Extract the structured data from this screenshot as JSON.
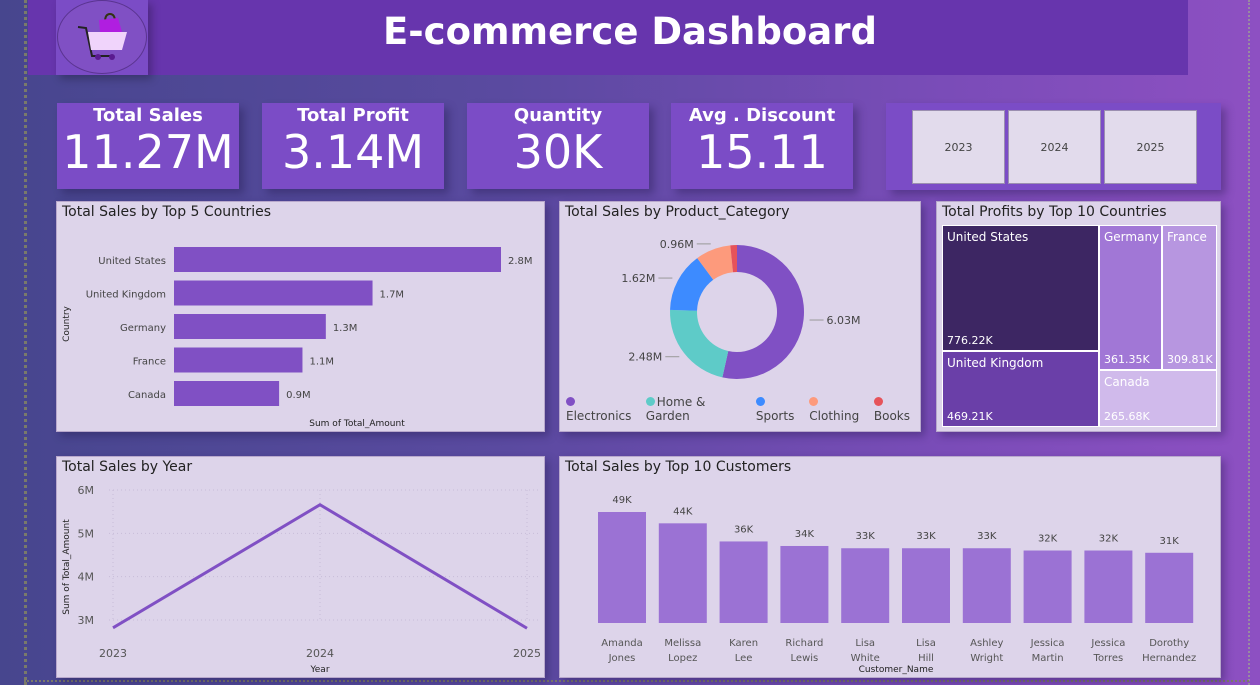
{
  "header": {
    "title": "E-commerce Dashboard",
    "logo_icon": "shopping-cart-icon"
  },
  "kpis": [
    {
      "label": "Total Sales",
      "value": "11.27M"
    },
    {
      "label": "Total Profit",
      "value": "3.14M"
    },
    {
      "label": "Quantity",
      "value": "30K"
    },
    {
      "label": "Avg . Discount",
      "value": "15.11"
    }
  ],
  "year_slicer": [
    "2023",
    "2024",
    "2025"
  ],
  "chart_data": [
    {
      "type": "bar",
      "orientation": "horizontal",
      "title": "Total Sales by Top 5 Countries",
      "xlabel": "Sum of Total_Amount",
      "ylabel": "Country",
      "categories": [
        "United States",
        "United Kingdom",
        "Germany",
        "France",
        "Canada"
      ],
      "values": [
        2.8,
        1.7,
        1.3,
        1.1,
        0.9
      ],
      "labels": [
        "2.8M",
        "1.7M",
        "1.3M",
        "1.1M",
        "0.9M"
      ],
      "color": "#8050c4"
    },
    {
      "type": "pie",
      "title": "Total Sales by Product_Category",
      "categories": [
        "Electronics",
        "Home & Garden",
        "Sports",
        "Clothing",
        "Books"
      ],
      "values": [
        6.03,
        2.48,
        1.62,
        0.96,
        0.18
      ],
      "labels": [
        "6.03M",
        "2.48M",
        "1.62M",
        "0.96M",
        ""
      ],
      "colors": [
        "#8050c4",
        "#5ecbc8",
        "#3d8bff",
        "#fd9a7c",
        "#e6535a"
      ]
    },
    {
      "type": "treemap",
      "title": "Total Profits by Top 10 Countries",
      "categories": [
        "United States",
        "United Kingdom",
        "Germany",
        "France",
        "Canada"
      ],
      "labels": [
        "776.22K",
        "469.21K",
        "361.35K",
        "309.81K",
        "265.68K"
      ],
      "values": [
        776.22,
        469.21,
        361.35,
        309.81,
        265.68
      ],
      "colors": [
        "#3d2663",
        "#6a3fa8",
        "#a177d6",
        "#b796e0",
        "#d0baeb"
      ]
    },
    {
      "type": "line",
      "title": "Total Sales by Year",
      "xlabel": "Year",
      "ylabel": "Sum of Total_Amount",
      "x": [
        "2023",
        "2024",
        "2025"
      ],
      "values": [
        2.82,
        5.66,
        2.81
      ],
      "yticks": [
        "3M",
        "4M",
        "5M",
        "6M"
      ],
      "ylim": [
        2.5,
        6
      ],
      "grid": true,
      "color": "#8050c4"
    },
    {
      "type": "bar",
      "title": "Total Sales by Top 10 Customers",
      "xlabel": "Customer_Name",
      "categories": [
        "Amanda Jones",
        "Melissa Lopez",
        "Karen Lee",
        "Richard Lewis",
        "Lisa White",
        "Lisa Hill",
        "Ashley Wright",
        "Jessica Martin",
        "Jessica Torres",
        "Dorothy Hernandez"
      ],
      "values": [
        49,
        44,
        36,
        34,
        33,
        33,
        33,
        32,
        32,
        31
      ],
      "labels": [
        "49K",
        "44K",
        "36K",
        "34K",
        "33K",
        "33K",
        "33K",
        "32K",
        "32K",
        "31K"
      ],
      "color": "#9b72d4"
    }
  ]
}
